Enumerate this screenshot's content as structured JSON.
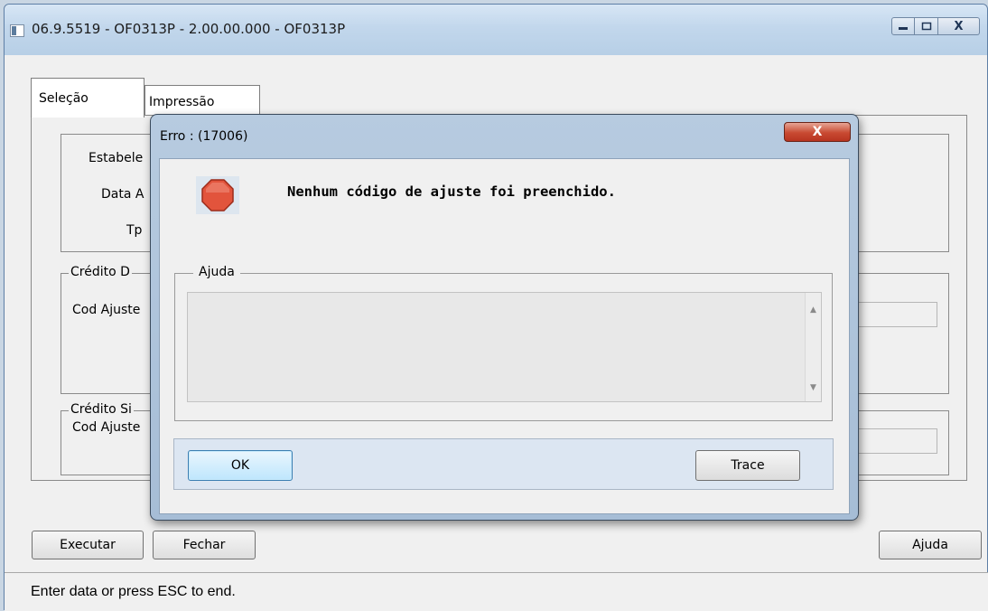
{
  "window": {
    "title": "06.9.5519 - OF0313P - 2.00.00.000 - OF0313P",
    "buttons": [
      "minimize",
      "maximize",
      "close"
    ],
    "close_glyph": "X"
  },
  "tabs": [
    {
      "label": "Seleção",
      "active": true
    },
    {
      "label": "Impressão",
      "active": false
    }
  ],
  "form": {
    "estabelecimento_label": "Estabele",
    "data_label": "Data A",
    "tp_label": "Tp",
    "credito_d_legend": "Crédito D",
    "cod_ajuste_label_1": "Cod Ajuste",
    "credito_s_legend": "Crédito Si",
    "cod_ajuste_label_2": "Cod Ajuste"
  },
  "footer": {
    "executar_label": "Executar",
    "fechar_label": "Fechar",
    "ajuda_label": "Ajuda"
  },
  "status_bar": {
    "text": "Enter data or press ESC to end."
  },
  "dialog": {
    "title": "Erro : (17006)",
    "close_glyph": "X",
    "icon": "stop-icon",
    "message": "Nenhum código de ajuste foi preenchido.",
    "help_legend": "Ajuda",
    "help_text": "",
    "ok_label": "OK",
    "trace_label": "Trace"
  },
  "colors": {
    "titlebar": "#c2d7ec",
    "dialog_close": "#c84a32",
    "stop_icon": "#e2543c",
    "ok_button": "#bee6fd"
  }
}
